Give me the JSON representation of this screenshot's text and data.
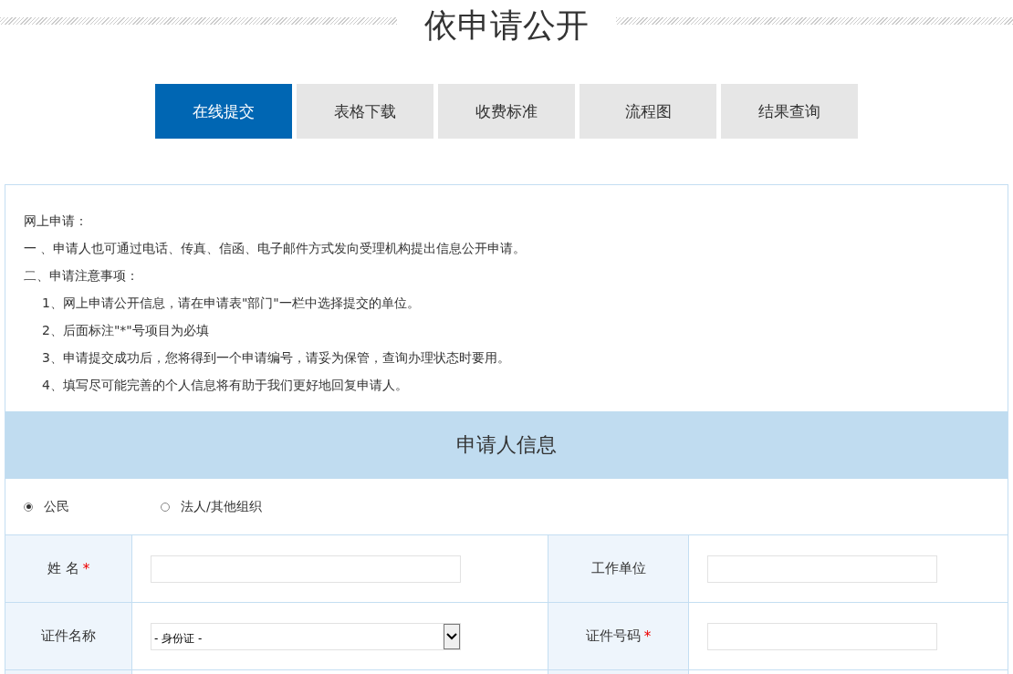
{
  "title": "依申请公开",
  "tabs": [
    {
      "label": "在线提交",
      "selected": true
    },
    {
      "label": "表格下载",
      "selected": false
    },
    {
      "label": "收费标准",
      "selected": false
    },
    {
      "label": "流程图",
      "selected": false
    },
    {
      "label": "结果查询",
      "selected": false
    }
  ],
  "notes": {
    "heading": "网上申请：",
    "items": [
      {
        "text": "一 、申请人也可通过电话、传真、信函、电子邮件方式发向受理机构提出信息公开申请。",
        "indented": false
      },
      {
        "text": "二、申请注意事项：",
        "indented": false
      },
      {
        "text": "1、网上申请公开信息，请在申请表\"部门\"一栏中选择提交的单位。",
        "indented": true
      },
      {
        "text": "2、后面标注\"*\"号项目为必填",
        "indented": true
      },
      {
        "text": "3、申请提交成功后，您将得到一个申请编号，请妥为保管，查询办理状态时要用。",
        "indented": true
      },
      {
        "text": "4、填写尽可能完善的个人信息将有助于我们更好地回复申请人。",
        "indented": true
      }
    ]
  },
  "section_title": "申请人信息",
  "applicant_types": [
    {
      "label": "公民",
      "selected": true
    },
    {
      "label": "法人/其他组织",
      "selected": false
    }
  ],
  "form_rows": [
    [
      {
        "label": "姓 名",
        "required_mark": "*",
        "kind": "input"
      },
      {
        "label": "工作单位",
        "kind": "input"
      }
    ],
    [
      {
        "label": "证件名称",
        "kind": "select",
        "value": "- 身份证 -"
      },
      {
        "label": "证件号码",
        "required_mark": "*",
        "kind": "input"
      }
    ]
  ]
}
